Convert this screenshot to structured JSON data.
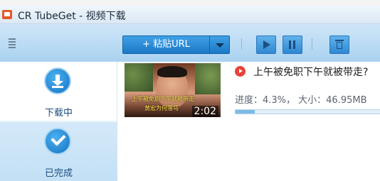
{
  "taskbar": {
    "items": [
      "",
      "",
      "",
      ""
    ]
  },
  "window": {
    "title": "CR TubeGet - 视频下载"
  },
  "toolbar": {
    "paste_url_label": "+ 粘贴URL"
  },
  "sidebar": {
    "items": [
      {
        "label": "下载中",
        "icon": "download-icon",
        "active": true
      },
      {
        "label": "已完成",
        "icon": "check-icon",
        "active": false
      }
    ]
  },
  "download": {
    "title": "上午被免职下午就被带走?",
    "thumbnail_caption_1": "上午被免职下午就被带走",
    "thumbnail_caption_2": "黄宏为何落马",
    "duration": "2:02",
    "progress_text": "进度：4.3%， 大小：46.95MB",
    "progress_fraction": 0.043
  },
  "colors": {
    "accent": "#1c79c6",
    "source_icon": "#e8413a",
    "progress_fill": "#7bbbe8"
  }
}
